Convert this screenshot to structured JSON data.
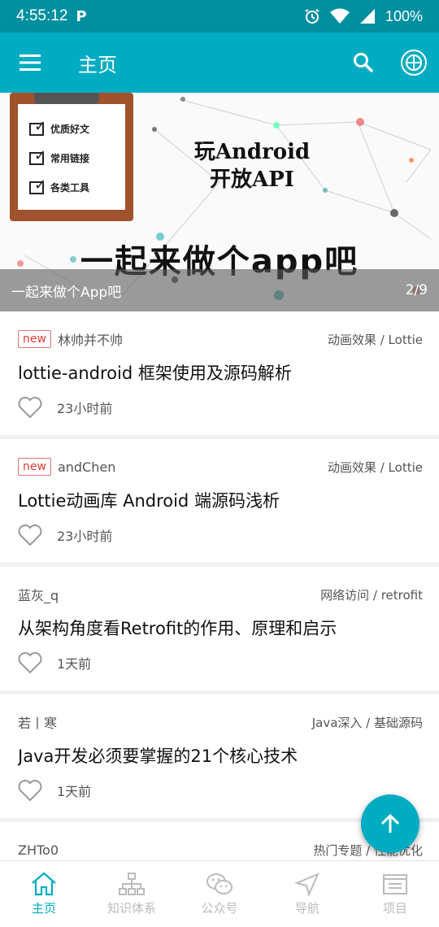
{
  "status_bar": {
    "time": "4:55:12",
    "notification_icon": "P",
    "battery": "100%",
    "icons": [
      "alarm-icon",
      "wifi-icon",
      "signal-icon"
    ]
  },
  "app_bar": {
    "title": "主页",
    "icons": [
      "menu-icon",
      "search-icon",
      "globe-icon"
    ]
  },
  "banner": {
    "headline_line1": "玩Android",
    "headline_line2": "开放API",
    "slogan": "一起来做个app吧",
    "clipboard_items": [
      "优质好文",
      "常用链接",
      "各类工具"
    ],
    "caption": "一起来做个App吧",
    "pager": "2/9"
  },
  "articles": [
    {
      "is_new": true,
      "new_label": "new",
      "author": "林帅并不帅",
      "category": "动画效果 / Lottie",
      "title": "lottie-android 框架使用及源码解析",
      "time": "23小时前"
    },
    {
      "is_new": true,
      "new_label": "new",
      "author": "andChen",
      "category": "动画效果 / Lottie",
      "title": "Lottie动画库 Android 端源码浅析",
      "time": "23小时前"
    },
    {
      "is_new": false,
      "author": "蓝灰_q",
      "category": "网络访问 / retrofit",
      "title": "从架构角度看Retrofit的作用、原理和启示",
      "time": "1天前"
    },
    {
      "is_new": false,
      "author": "若丨寒",
      "category": "Java深入 / 基础源码",
      "title": "Java开发必须要掌握的21个核心技术",
      "time": "1天前"
    },
    {
      "is_new": false,
      "author": "ZHTo0",
      "category": "热门专题 / 性能优化",
      "title": "",
      "time": ""
    }
  ],
  "bottom_nav": [
    {
      "label": "主页",
      "icon": "home-icon",
      "active": true
    },
    {
      "label": "知识体系",
      "icon": "tree-icon",
      "active": false
    },
    {
      "label": "公众号",
      "icon": "wechat-icon",
      "active": false
    },
    {
      "label": "导航",
      "icon": "navigation-icon",
      "active": false
    },
    {
      "label": "项目",
      "icon": "project-icon",
      "active": false
    }
  ],
  "colors": {
    "primary": "#00acc1",
    "status_bar": "#008f9f",
    "new_badge": "#e53935",
    "inactive_nav": "#bbbbbb"
  }
}
